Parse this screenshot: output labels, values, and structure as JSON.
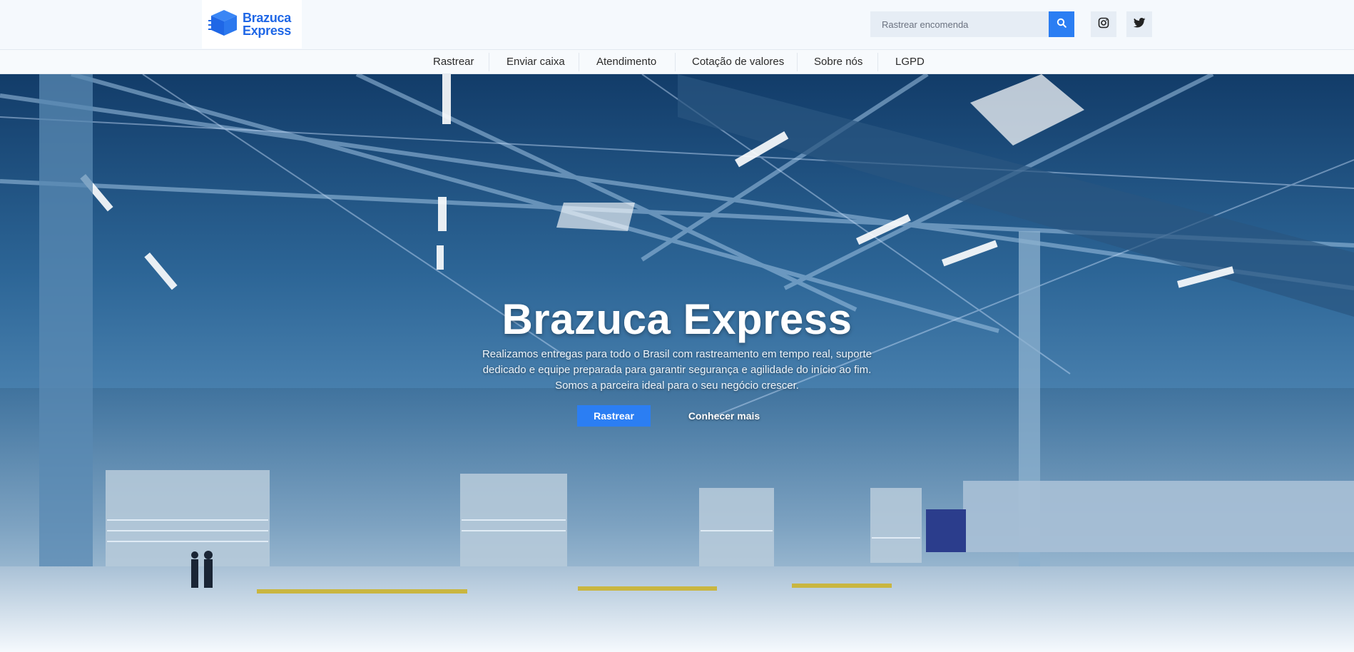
{
  "header": {
    "logo": {
      "line1": "Brazuca",
      "line2": "Express",
      "icon": "box-icon"
    },
    "search": {
      "placeholder": "Rastrear encomenda",
      "value": "",
      "button_icon": "search-icon"
    },
    "social": [
      {
        "name": "instagram",
        "icon": "instagram-icon"
      },
      {
        "name": "twitter",
        "icon": "twitter-icon"
      }
    ]
  },
  "nav": {
    "items": [
      {
        "label": "Rastrear"
      },
      {
        "label": "Enviar caixa"
      },
      {
        "label": "Atendimento"
      },
      {
        "label": "Cotação de valores"
      },
      {
        "label": "Sobre nós"
      },
      {
        "label": "LGPD"
      }
    ]
  },
  "hero": {
    "title": "Brazuca Express",
    "description": "Realizamos entregas para todo o Brasil com rastreamento em tempo real, suporte dedicado e equipe preparada para garantir segurança e agilidade do início ao fim. Somos a parceira ideal para o seu negócio crescer.",
    "primary_button": "Rastrear",
    "secondary_button": "Conhecer mais"
  },
  "colors": {
    "accent": "#2b7ef3",
    "brand_blue": "#1f67e6",
    "background": "#f5f9fd"
  }
}
